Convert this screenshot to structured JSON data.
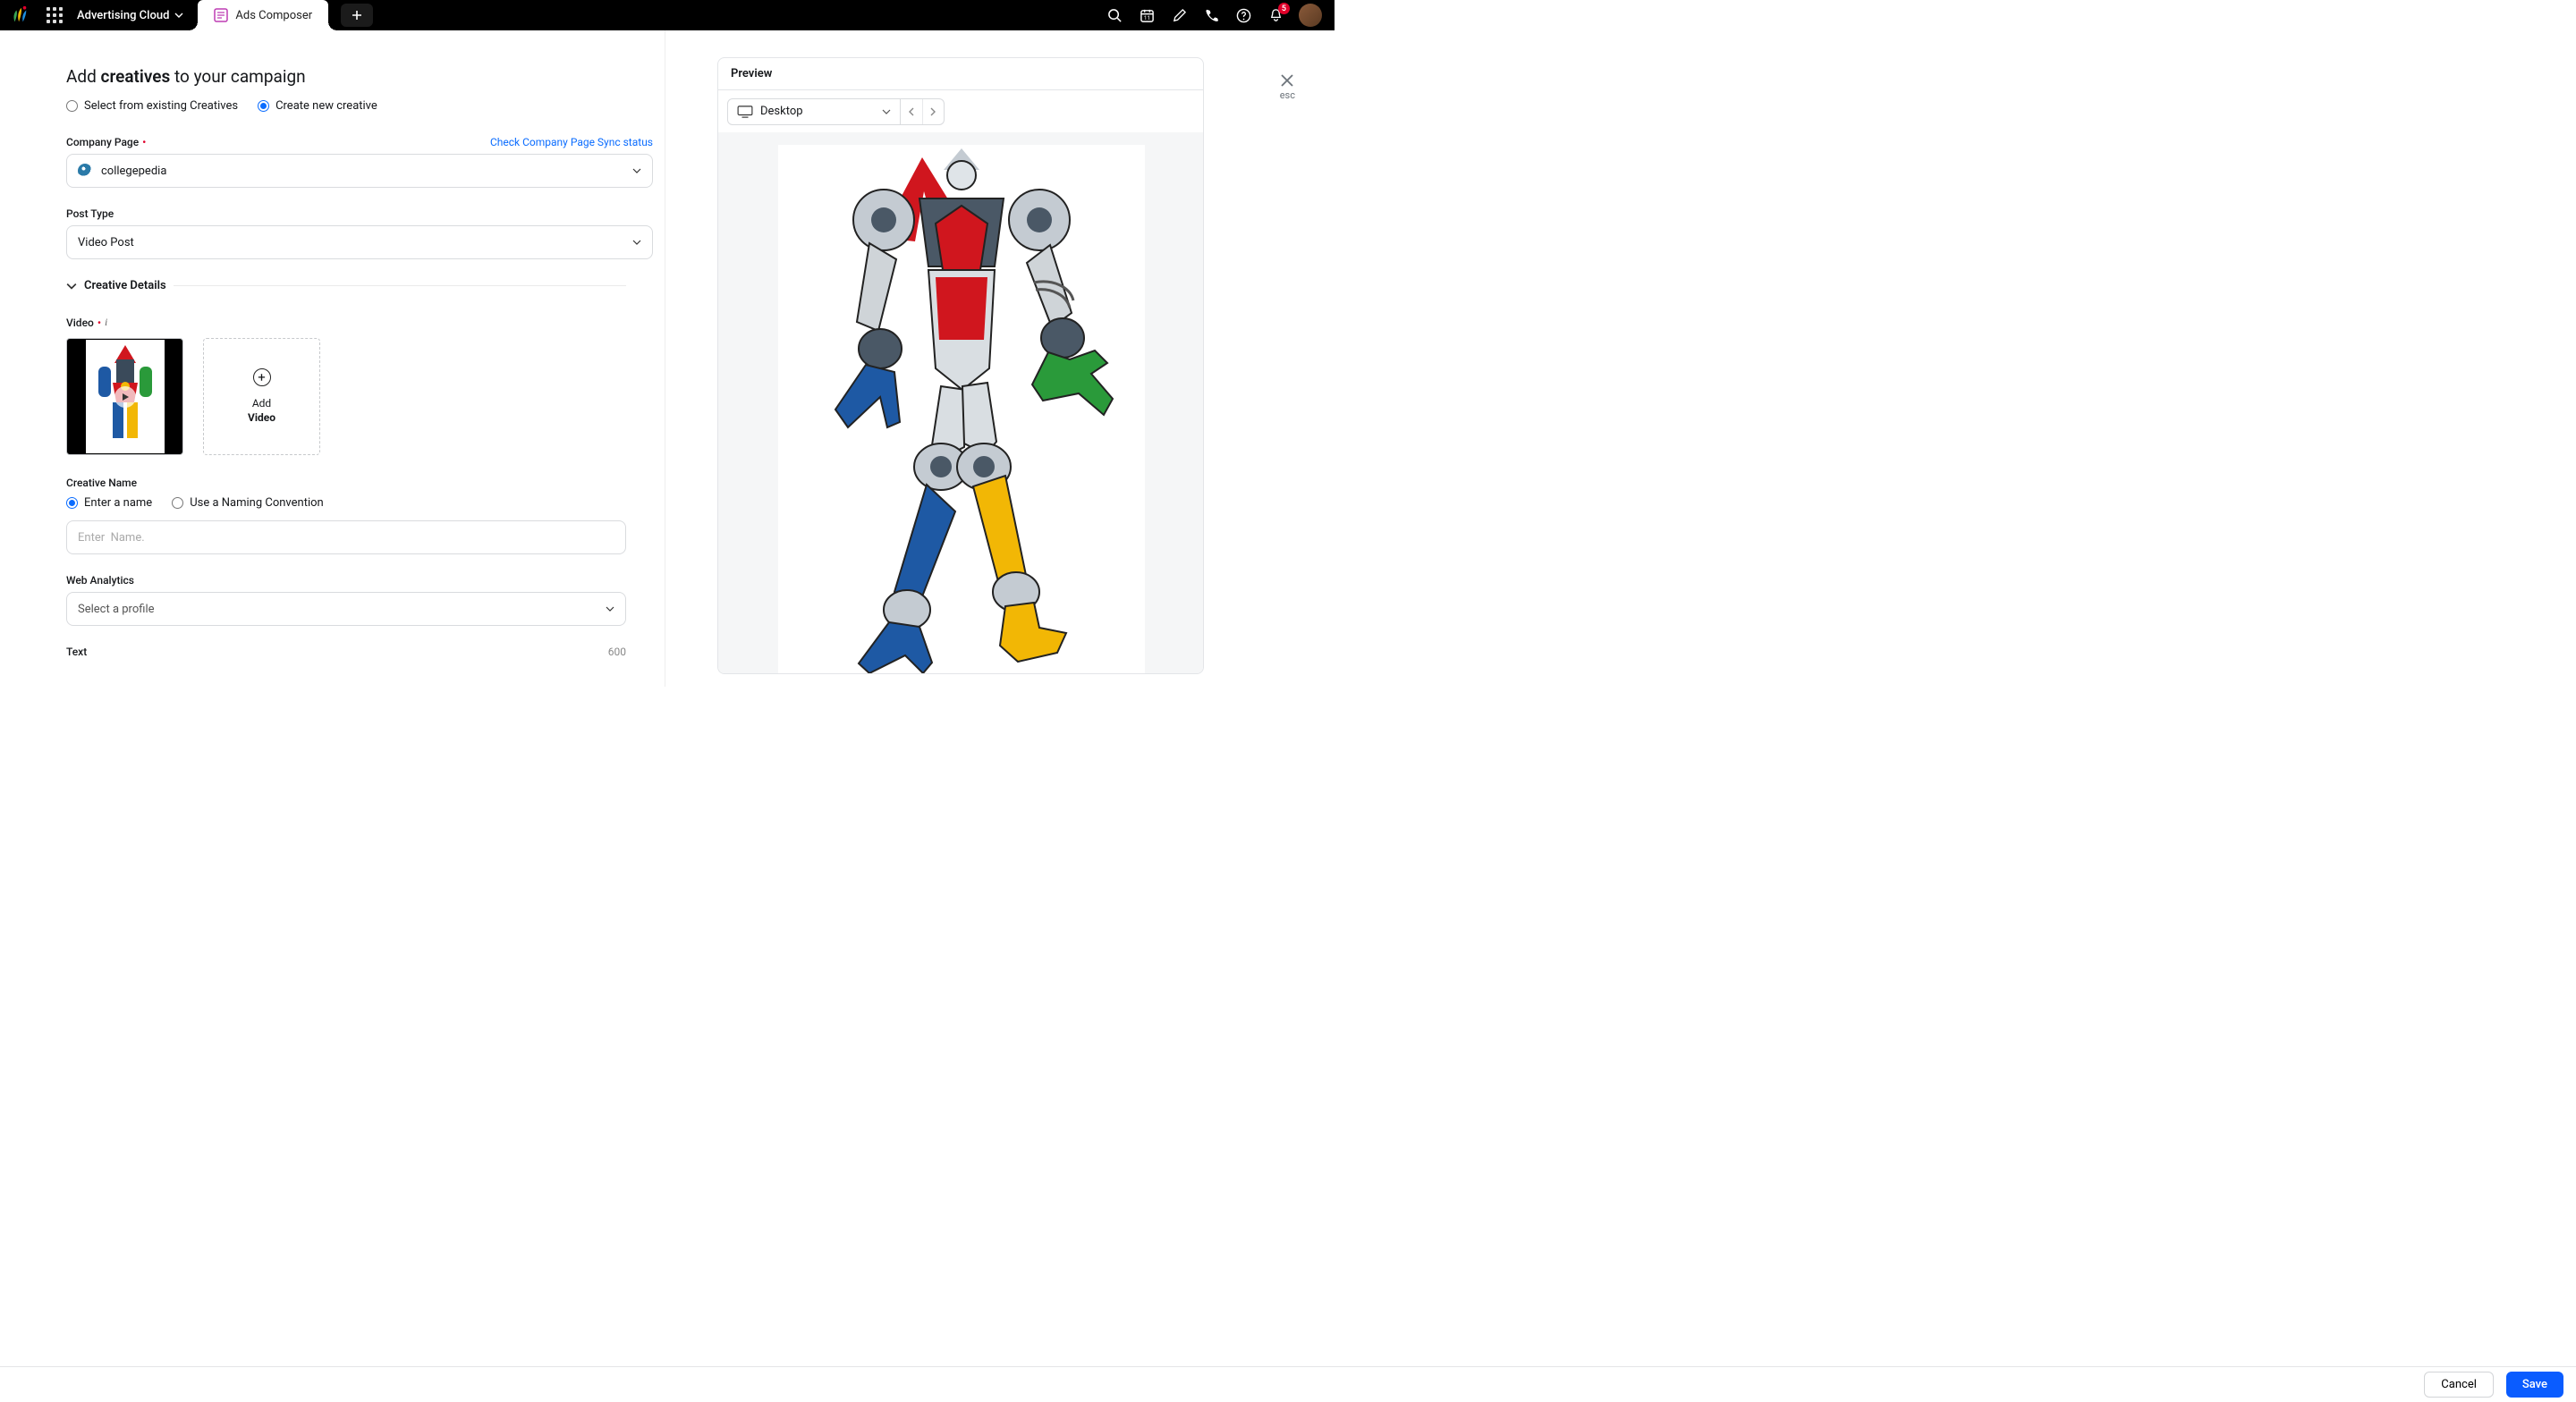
{
  "header": {
    "product": "Advertising Cloud",
    "tab_label": "Ads Composer",
    "notification_count": "5"
  },
  "form": {
    "title_prefix": "Add",
    "title_bold": "creatives",
    "title_suffix": "to your campaign",
    "radio_existing": "Select from existing Creatives",
    "radio_new": "Create new creative",
    "company_page_label": "Company Page",
    "company_page_sync": "Check Company Page Sync status",
    "company_page_value": "collegepedia",
    "post_type_label": "Post Type",
    "post_type_value": "Video Post",
    "creative_details": "Creative Details",
    "video_label": "Video",
    "add_video_line1": "Add",
    "add_video_line2": "Video",
    "creative_name_label": "Creative Name",
    "name_enter": "Enter a name",
    "name_convention": "Use a Naming Convention",
    "name_placeholder": "Enter  Name.",
    "web_analytics_label": "Web Analytics",
    "web_analytics_placeholder": "Select a profile",
    "text_label": "Text",
    "text_count": "600"
  },
  "preview": {
    "header": "Preview",
    "device": "Desktop",
    "close_label": "esc"
  },
  "footer": {
    "cancel": "Cancel",
    "save": "Save"
  }
}
